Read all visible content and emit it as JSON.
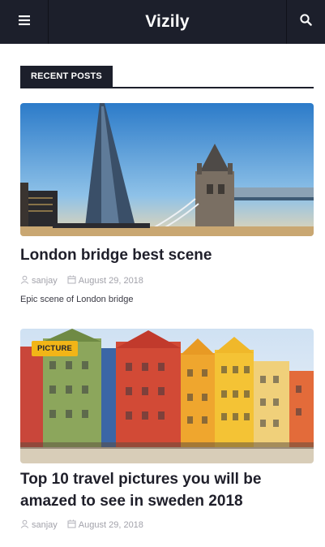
{
  "header": {
    "brand": "Vizily",
    "menu_icon": "hamburger-menu-icon",
    "search_icon": "search-icon"
  },
  "section": {
    "title": "RECENT POSTS"
  },
  "posts": [
    {
      "title": "London bridge best scene",
      "author": "sanjay",
      "date": "August 29, 2018",
      "excerpt": "Epic scene of London bridge",
      "badge": ""
    },
    {
      "title": "Top 10 travel pictures you will be amazed to see in sweden 2018",
      "author": "sanjay",
      "date": "August 29, 2018",
      "excerpt": "",
      "badge": "PICTURE"
    }
  ],
  "colors": {
    "header_bg": "#1c1f2b",
    "badge_bg": "#f2b517",
    "meta_text": "#a2a2aa"
  }
}
